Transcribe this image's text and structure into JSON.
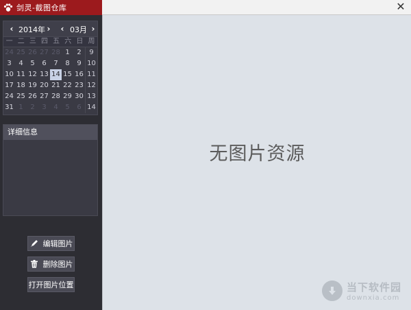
{
  "window": {
    "title": "剑灵-截图仓库"
  },
  "calendar": {
    "year_label": "2014年",
    "month_label": "03月",
    "weekday_headers": [
      "一",
      "二",
      "三",
      "四",
      "五",
      "六",
      "日",
      "周"
    ],
    "rows": [
      {
        "days": [
          "24",
          "25",
          "26",
          "27",
          "28",
          "1",
          "2"
        ],
        "week": "9"
      },
      {
        "days": [
          "3",
          "4",
          "5",
          "6",
          "7",
          "8",
          "9"
        ],
        "week": "10"
      },
      {
        "days": [
          "10",
          "11",
          "12",
          "13",
          "14",
          "15",
          "16"
        ],
        "week": "11"
      },
      {
        "days": [
          "17",
          "18",
          "19",
          "20",
          "21",
          "22",
          "23"
        ],
        "week": "12"
      },
      {
        "days": [
          "24",
          "25",
          "26",
          "27",
          "28",
          "29",
          "30"
        ],
        "week": "13"
      },
      {
        "days": [
          "31",
          "1",
          "2",
          "3",
          "4",
          "5",
          "6"
        ],
        "week": "14"
      }
    ],
    "selected_day": "14"
  },
  "detail": {
    "header": "详细信息"
  },
  "buttons": {
    "edit": "编辑图片",
    "delete": "删除图片",
    "open_location": "打开图片位置"
  },
  "main": {
    "empty_message": "无图片资源"
  },
  "watermark": {
    "cn": "当下软件园",
    "en": "downxia.com"
  },
  "colors": {
    "title_red": "#9c1a1d",
    "sidebar_bg": "#2d2d33",
    "main_bg": "#dde2e8"
  }
}
